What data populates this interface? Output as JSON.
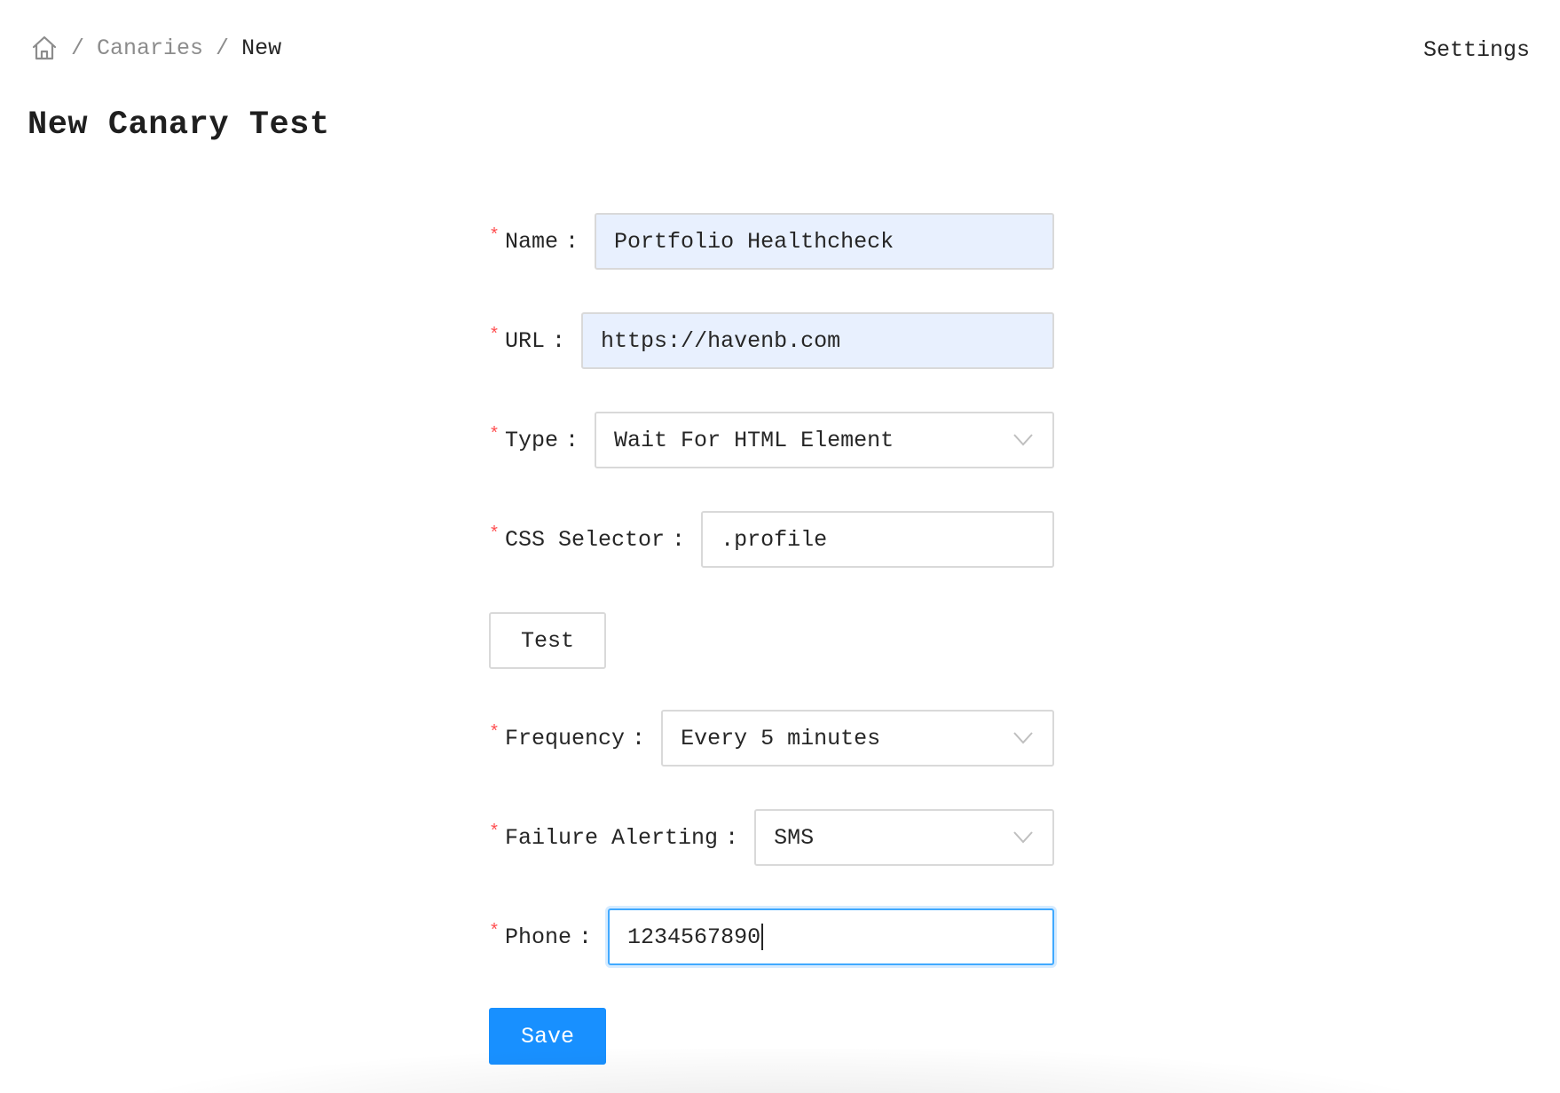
{
  "breadcrumb": {
    "home_icon": "home-icon",
    "separator": "/",
    "items": [
      {
        "label": "Canaries"
      },
      {
        "label": "New"
      }
    ]
  },
  "header": {
    "settings_label": "Settings"
  },
  "page": {
    "title": "New Canary Test"
  },
  "form": {
    "required_marker": "*",
    "label_colon": ":",
    "name": {
      "label": "Name",
      "value": "Portfolio Healthcheck"
    },
    "url": {
      "label": "URL",
      "value": "https://havenb.com"
    },
    "type": {
      "label": "Type",
      "value": "Wait For HTML Element",
      "icon": "chevron-down-icon"
    },
    "css_selector": {
      "label": "CSS Selector",
      "value": ".profile"
    },
    "test_button_label": "Test",
    "frequency": {
      "label": "Frequency",
      "value": "Every 5 minutes",
      "icon": "chevron-down-icon"
    },
    "failure_alerting": {
      "label": "Failure Alerting",
      "value": "SMS",
      "icon": "chevron-down-icon"
    },
    "phone": {
      "label": "Phone",
      "value": "1234567890"
    },
    "save_button_label": "Save"
  },
  "colors": {
    "primary": "#1890ff",
    "required": "#ff4d4f",
    "autofill_bg": "#e8f0fe",
    "focus_border": "#40a9ff"
  }
}
